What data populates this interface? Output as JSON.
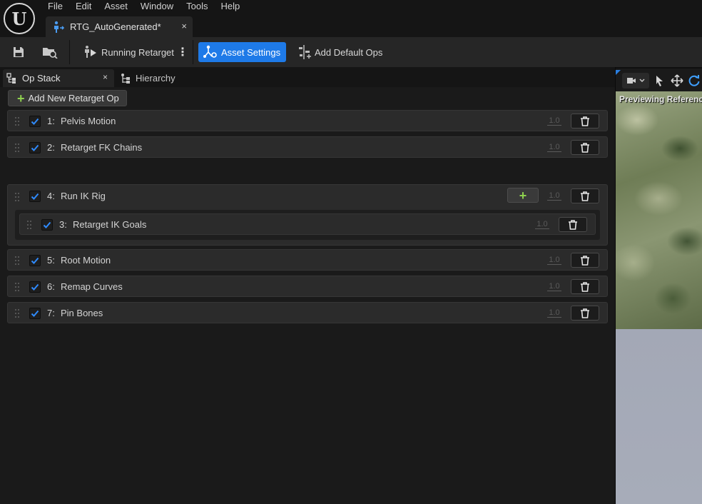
{
  "app": {
    "logo_text": "U",
    "menu": [
      "File",
      "Edit",
      "Asset",
      "Window",
      "Tools",
      "Help"
    ],
    "document_tab": {
      "title": "RTG_AutoGenerated*",
      "close": "×"
    }
  },
  "toolbar": {
    "running_retarget_label": "Running Retarget",
    "asset_settings_label": "Asset Settings",
    "add_default_ops_label": "Add Default Ops",
    "overflow_glyph": "⋮"
  },
  "panel_tabs": [
    {
      "label": "Op Stack",
      "close": "×",
      "active": true
    },
    {
      "label": "Hierarchy",
      "active": false
    }
  ],
  "op_stack": {
    "add_button_label": "Add New Retarget Op",
    "add_button_glyph": "+",
    "ops": [
      {
        "index": "1:",
        "name": "Pelvis Motion",
        "enabled": true,
        "weight": "1.0"
      },
      {
        "index": "2:",
        "name": "Retarget FK Chains",
        "enabled": true,
        "weight": "1.0"
      },
      {
        "index": "4:",
        "name": "Run IK Rig",
        "enabled": true,
        "weight": "1.0",
        "add_child_glyph": "+"
      },
      {
        "index": "3:",
        "name": "Retarget IK Goals",
        "enabled": true,
        "weight": "1.0"
      },
      {
        "index": "5:",
        "name": "Root Motion",
        "enabled": true,
        "weight": "1.0"
      },
      {
        "index": "6:",
        "name": "Remap Curves",
        "enabled": true,
        "weight": "1.0"
      },
      {
        "index": "7:",
        "name": "Pin Bones",
        "enabled": true,
        "weight": "1.0"
      }
    ]
  },
  "viewport": {
    "preview_text": "Previewing Reference"
  },
  "colors": {
    "accent_blue": "#1e7ae8",
    "add_green": "#8fd14f",
    "checkbox_check": "#2f8bff"
  }
}
